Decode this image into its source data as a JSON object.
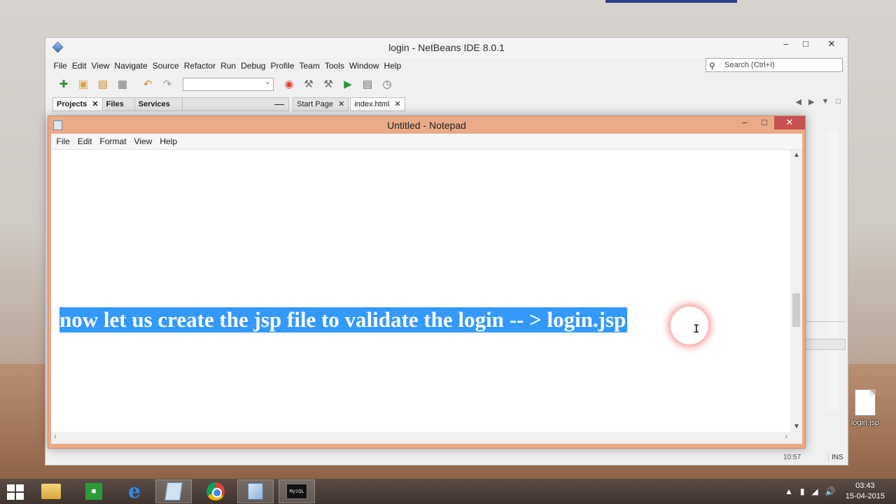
{
  "netbeans": {
    "title": "login - NetBeans IDE 8.0.1",
    "menu": [
      "File",
      "Edit",
      "View",
      "Navigate",
      "Source",
      "Refactor",
      "Run",
      "Debug",
      "Profile",
      "Team",
      "Tools",
      "Window",
      "Help"
    ],
    "search_placeholder": "Search (Ctrl+I)",
    "left_tabs": [
      "Projects",
      "Files",
      "Services"
    ],
    "editor_tabs": [
      "Start Page",
      "index.html"
    ],
    "status_position": "10:57",
    "status_mode": "INS"
  },
  "notepad": {
    "title": "Untitled - Notepad",
    "menu": [
      "File",
      "Edit",
      "Format",
      "View",
      "Help"
    ],
    "selected_text": "now let us create the jsp file to validate the login -- > login.jsp"
  },
  "desktop": {
    "file_label": "login.jsp"
  },
  "taskbar": {
    "time": "03:43",
    "date": "15-04-2015",
    "mysql_label": "MySQL"
  },
  "colors": {
    "selection": "#3399ff",
    "notepad_frame": "#eaaa88",
    "close_button": "#c75050"
  }
}
